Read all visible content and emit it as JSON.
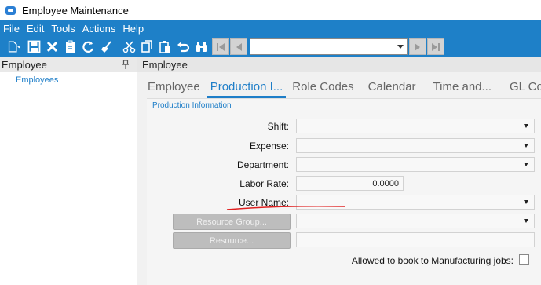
{
  "window": {
    "title": "Employee Maintenance"
  },
  "menu": [
    "File",
    "Edit",
    "Tools",
    "Actions",
    "Help"
  ],
  "toolbar": {
    "icons": [
      "new-icon",
      "save-icon",
      "delete-icon",
      "clipboard-icon",
      "refresh-icon",
      "clear-icon",
      "cut-icon",
      "copy-icon",
      "paste-icon",
      "undo-icon",
      "binoculars-icon"
    ],
    "nav_value": ""
  },
  "left_panel": {
    "header": "Employee",
    "tree_item": "Employees"
  },
  "main": {
    "header": "Employee",
    "tabs": [
      "Employee",
      "Production I...",
      "Role Codes",
      "Calendar",
      "Time and...",
      "GL Co"
    ],
    "active_tab": 1,
    "section": "Production Information",
    "fields": {
      "shift": {
        "label": "Shift:",
        "value": ""
      },
      "expense": {
        "label": "Expense:",
        "value": ""
      },
      "department": {
        "label": "Department:",
        "value": ""
      },
      "labor_rate": {
        "label": "Labor Rate:",
        "value": "0.0000"
      },
      "user_name": {
        "label": "User Name:",
        "value": ""
      }
    },
    "buttons": {
      "resource_group": "Resource Group...",
      "resource": "Resource..."
    },
    "checkbox": {
      "label": "Allowed to book to Manufacturing jobs:",
      "checked": false
    }
  },
  "colors": {
    "accent": "#1e80c8",
    "annotation": "#e02020"
  }
}
